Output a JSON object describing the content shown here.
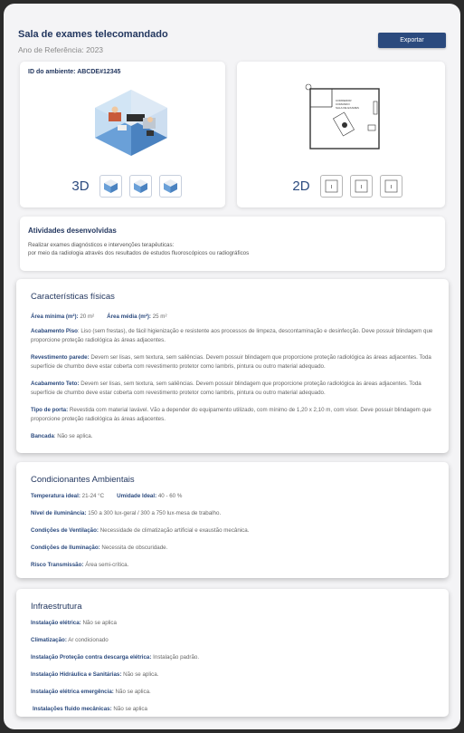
{
  "header": {
    "title": "Sala de exames telecomandado",
    "subtitle": "Ano de Referência: 2023",
    "export_label": "Exportar"
  },
  "views": {
    "env_id": "ID do ambiente: ABCDE#12345",
    "label_3d": "3D",
    "label_2d": "2D",
    "plan_text_1": "CORREDOR",
    "plan_text_2": "COMANDO",
    "plan_text_3": "SALA DE EXAMES"
  },
  "activities": {
    "title": "Atividades desenvolvidas",
    "line1": "Realizar exames diagnósticos e intervenções terapêuticas:",
    "line2": "por meio da radiologia através dos resultados de estudos fluoroscópicos ou radiográficos"
  },
  "physical": {
    "title": "Características físicas",
    "area_min_label": "Área mínima (m²):",
    "area_min_value": " 20 m²",
    "area_avg_label": "Área média (m²):",
    "area_avg_value": " 25 m²",
    "floor_label": "Acabamento Piso",
    "floor_value": ": Liso (sem frestas), de fácil higienização e resistente aos processos de limpeza, descontaminação e desinfecção. Deve possuir blindagem que proporcione proteção radiológica às áreas adjacentes.",
    "wall_label": "Revestimento parede:",
    "wall_value": " Devem ser lisas, sem textura, sem saliências. Devem possuir blindagem que proporcione proteção radiológica às áreas adjacentes. Toda superfície de chumbo deve estar coberta com revestimento protetor como lambris, pintura ou outro material adequado.",
    "ceiling_label": "Acabamento Teto:",
    "ceiling_value": " Devem ser lisas, sem textura, sem saliências. Devem possuir blindagem que proporcione proteção radiológica às áreas adjacentes. Toda superfície de chumbo deve estar coberta com revestimento protetor como lambris, pintura ou outro material adequado.",
    "door_label": "Tipo de porta:",
    "door_value": " Revestida com material lavável. Vão a depender do equipamento utilizado, com mínimo de 1,20 x 2,10 m, com visor. Deve possuir blindagem que proporcione proteção radiológica às áreas adjacentes.",
    "bench_label": "Bancada",
    "bench_value": ": Não se aplica."
  },
  "environment": {
    "title": "Condicionantes Ambientais",
    "temp_label": "Temperatura ideal:",
    "temp_value": " 21-24 °C",
    "hum_label": "Umidade Ideal:",
    "hum_value": " 40 - 60 %",
    "lux_label": "Nível de iluminância:",
    "lux_value": " 150 a 300 lux-geral / 300 a 750 lux-mesa de trabalho.",
    "vent_label": "Condições de Ventilação:",
    "vent_value": " Necessidade de climatização artificial e exaustão mecânica.",
    "light_label": "Condições de Iluminação:",
    "light_value": " Necessita de obscuridade.",
    "risk_label": "Risco Transmissão:",
    "risk_value": " Área semi-crítica."
  },
  "infra": {
    "title": "Infraestrutura",
    "elec_label": "Instalação elétrica:",
    "elec_value": "  Não se aplica",
    "clim_label": "Climatização:",
    "clim_value": " Ar condicionado",
    "spda_label": "Instalação Proteção contra descarga elétrica:",
    "spda_value": " Instalação padrão.",
    "hydro_label": "Instalação Hidráulica e Sanitárias:",
    "hydro_value": " Não se aplica.",
    "emerg_label": "Instalação elétrica emergência:",
    "emerg_value": " Não se aplica.",
    "fluid_label": "Instalações fluido mecânicas:",
    "fluid_value": " Não se aplica"
  }
}
